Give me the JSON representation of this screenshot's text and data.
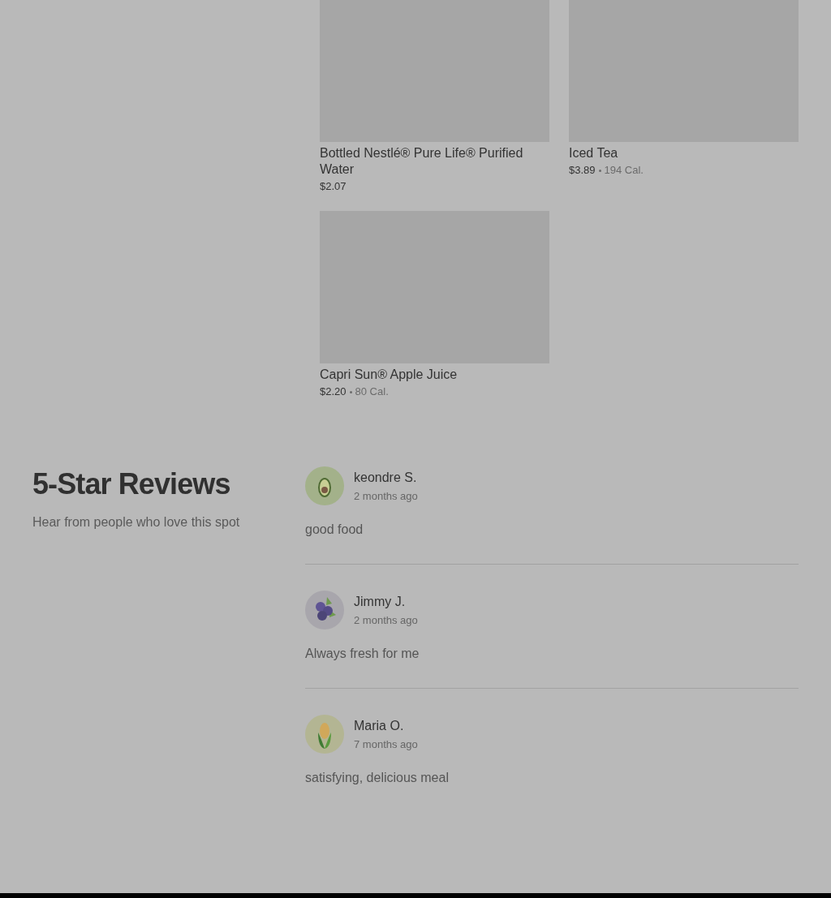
{
  "products": [
    {
      "name": "Bottled Nestlé® Pure Life® Purified Water",
      "price": "$2.07"
    },
    {
      "name": "Iced Tea",
      "price": "$3.89",
      "calories": "194 Cal."
    },
    {
      "name": "Capri Sun® Apple Juice",
      "price": "$2.20",
      "calories": "80 Cal."
    }
  ],
  "reviews_section": {
    "title": "5-Star Reviews",
    "subtitle": "Hear from people who love this spot"
  },
  "reviews": [
    {
      "name": "keondre S.",
      "time": "2 months ago",
      "text": "good food",
      "kind": "avocado"
    },
    {
      "name": "Jimmy J.",
      "time": "2 months ago",
      "text": "Always fresh for me",
      "kind": "blueberry"
    },
    {
      "name": "Maria O.",
      "time": "7 months ago",
      "text": "satisfying, delicious meal",
      "kind": "corn"
    }
  ]
}
